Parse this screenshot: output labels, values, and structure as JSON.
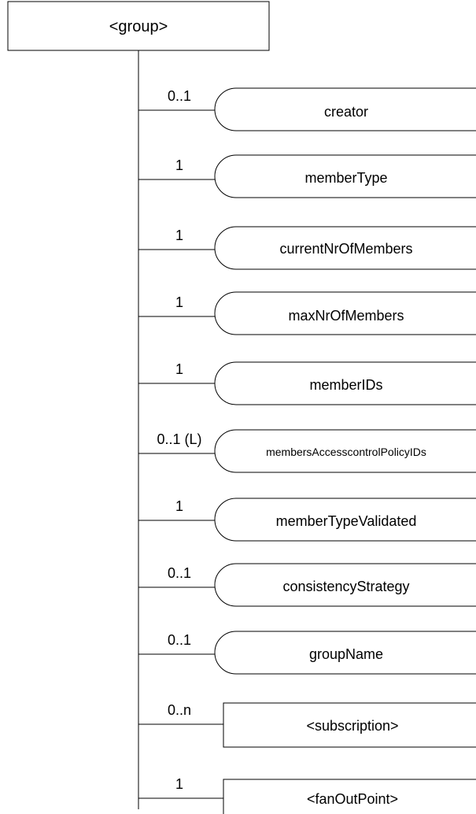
{
  "root": {
    "label": "<group>"
  },
  "children": [
    {
      "cardinality": "0..1",
      "label": "creator",
      "shape": "rounded"
    },
    {
      "cardinality": "1",
      "label": "memberType",
      "shape": "rounded"
    },
    {
      "cardinality": "1",
      "label": "currentNrOfMembers",
      "shape": "rounded"
    },
    {
      "cardinality": "1",
      "label": "maxNrOfMembers",
      "shape": "rounded"
    },
    {
      "cardinality": "1",
      "label": "memberIDs",
      "shape": "rounded"
    },
    {
      "cardinality": "0..1 (L)",
      "label": "membersAccesscontrolPolicyIDs",
      "shape": "rounded"
    },
    {
      "cardinality": "1",
      "label": "memberTypeValidated",
      "shape": "rounded"
    },
    {
      "cardinality": "0..1",
      "label": "consistencyStrategy",
      "shape": "rounded"
    },
    {
      "cardinality": "0..1",
      "label": "groupName",
      "shape": "rounded"
    },
    {
      "cardinality": "0..n",
      "label": "<subscription>",
      "shape": "rect"
    },
    {
      "cardinality": "1",
      "label": "<fanOutPoint>",
      "shape": "rect"
    }
  ]
}
